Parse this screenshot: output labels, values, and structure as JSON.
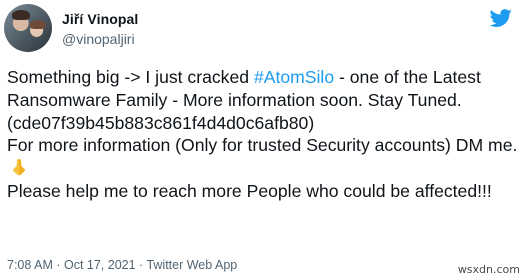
{
  "author": {
    "display_name": "Jiří Vinopal",
    "handle": "@vinopaljiri"
  },
  "tweet": {
    "line1_pre": "Something big -> I just cracked ",
    "hashtag": "#AtomSilo",
    "line1_post": " - one of the Latest Ransomware Family - More information soon. Stay Tuned. (cde07f39b45b883c861f4d4d0c6afb80)\nFor more information (Only for trusted Security accounts) DM me.",
    "line2": "\nPlease help me to reach more People who could be affected!!!"
  },
  "meta": {
    "time": "7:08 AM",
    "separator": " · ",
    "date": "Oct 17, 2021",
    "separator2": " · ",
    "source": "Twitter Web App"
  },
  "watermark": "wsxdn.com",
  "icons": {
    "logo": "twitter-bird-icon",
    "emoji": "folded-hands-icon"
  },
  "colors": {
    "accent": "#1d9bf0",
    "text": "#0f1419",
    "muted": "#536471"
  }
}
